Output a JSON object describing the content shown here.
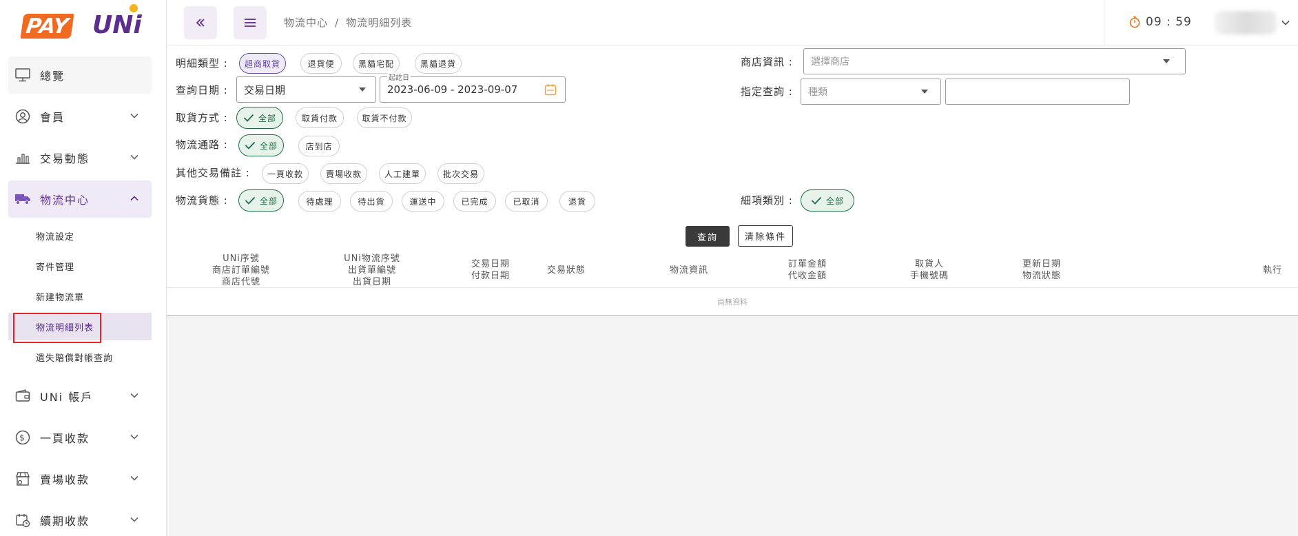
{
  "logo": {
    "pay": "PAY",
    "uni": "UNi"
  },
  "sidebar": {
    "items": [
      {
        "label": "總覽",
        "icon": "monitor-icon"
      },
      {
        "label": "會員",
        "icon": "user-circle-icon"
      },
      {
        "label": "交易動態",
        "icon": "bar-chart-icon"
      },
      {
        "label": "物流中心",
        "icon": "truck-icon"
      },
      {
        "label": "UNi 帳戶",
        "icon": "wallet-icon"
      },
      {
        "label": "一頁收款",
        "icon": "dollar-circle-icon"
      },
      {
        "label": "賣場收款",
        "icon": "store-icon"
      },
      {
        "label": "續期收款",
        "icon": "calendar-clock-icon"
      }
    ],
    "logistics_sub": [
      "物流設定",
      "寄件管理",
      "新建物流單",
      "物流明細列表",
      "遺失賠償對帳查詢"
    ]
  },
  "header": {
    "breadcrumb": [
      "物流中心",
      "物流明細列表"
    ],
    "sep": "/",
    "timer": "09 : 59"
  },
  "filters": {
    "detail_type": {
      "label": "明細類型 :",
      "options": [
        "超商取貨",
        "退貨便",
        "黑貓宅配",
        "黑貓退貨"
      ]
    },
    "query_date": {
      "label": "查詢日期 :",
      "select_value": "交易日期",
      "date_label": "起訖日",
      "date_range": "2023-06-09 - 2023-09-07"
    },
    "pickup_method": {
      "label": "取貨方式 :",
      "options": [
        "全部",
        "取貨付款",
        "取貨不付款"
      ]
    },
    "channel": {
      "label": "物流通路 :",
      "options": [
        "全部",
        "店到店"
      ]
    },
    "other_notes": {
      "label": "其他交易備註 :",
      "options": [
        "一頁收款",
        "賣場收款",
        "人工建單",
        "批次交易"
      ]
    },
    "logistics_status": {
      "label": "物流貨態 :",
      "options": [
        "全部",
        "待處理",
        "待出貨",
        "運送中",
        "已完成",
        "已取消",
        "退貨"
      ]
    },
    "store_info": {
      "label": "商店資訊 :",
      "placeholder": "選擇商店"
    },
    "specific_query": {
      "label": "指定查詢 :",
      "placeholder": "種類"
    },
    "item_category": {
      "label": "細項類別 :",
      "options": [
        "全部"
      ]
    },
    "query_button": "查詢",
    "clear_button": "清除條件"
  },
  "table": {
    "columns": [
      [
        "UNi序號",
        "商店訂單編號",
        "商店代號"
      ],
      [
        "UNi物流序號",
        "出貨單編號",
        "出貨日期"
      ],
      [
        "交易日期",
        "付款日期"
      ],
      [
        "交易狀態"
      ],
      [
        "物流資訊"
      ],
      [
        "訂單金額",
        "代收金額"
      ],
      [
        "取貨人",
        "手機號碼"
      ],
      [
        "更新日期",
        "物流狀態"
      ],
      [
        "執行"
      ]
    ],
    "empty_text": "尚無資料"
  },
  "colors": {
    "brand_orange": "#f26a21",
    "brand_purple": "#5b2d8e",
    "selected_green": "#1f6e46",
    "highlight_red": "#e12727"
  }
}
